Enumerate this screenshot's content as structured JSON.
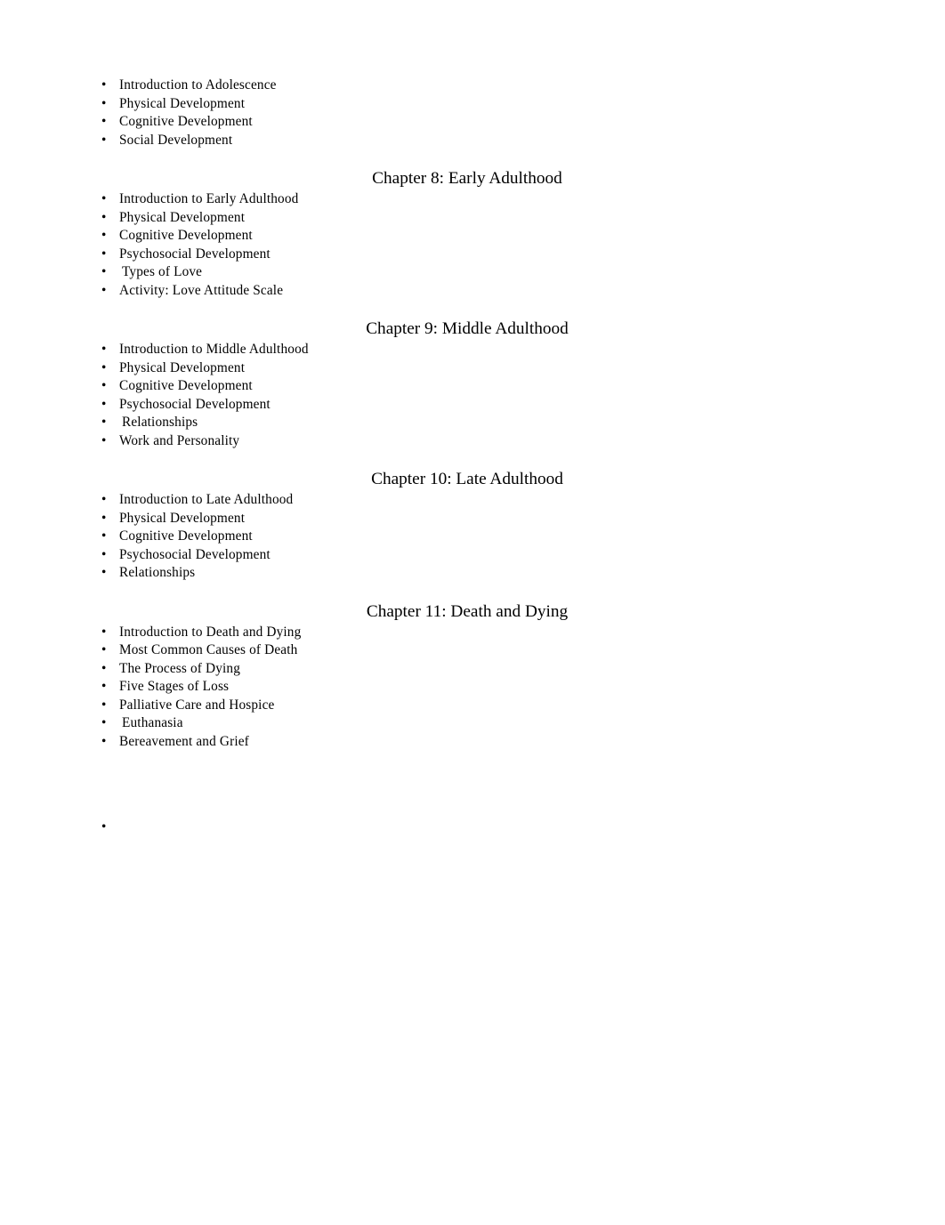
{
  "document": {
    "background_color": "#ffffff",
    "text_color": "#000000",
    "bullet_glyph": "•"
  },
  "sections": [
    {
      "heading": null,
      "items": [
        {
          "label": "Introduction to Adolescence",
          "indent": false
        },
        {
          "label": "Physical Development",
          "indent": false
        },
        {
          "label": "Cognitive Development",
          "indent": false
        },
        {
          "label": "Social Development",
          "indent": false
        }
      ]
    },
    {
      "heading": "Chapter 8: Early Adulthood",
      "items": [
        {
          "label": "Introduction to Early Adulthood",
          "indent": false
        },
        {
          "label": "Physical Development",
          "indent": false
        },
        {
          "label": "Cognitive Development",
          "indent": false
        },
        {
          "label": "Psychosocial Development",
          "indent": false
        },
        {
          "label": "Types of Love",
          "indent": true
        },
        {
          "label": "Activity: Love Attitude Scale",
          "indent": false
        }
      ]
    },
    {
      "heading": "Chapter 9: Middle Adulthood",
      "items": [
        {
          "label": "Introduction to Middle Adulthood",
          "indent": false
        },
        {
          "label": "Physical Development",
          "indent": false
        },
        {
          "label": "Cognitive Development",
          "indent": false
        },
        {
          "label": "Psychosocial Development",
          "indent": false
        },
        {
          "label": "Relationships",
          "indent": true
        },
        {
          "label": "Work and Personality",
          "indent": false
        }
      ]
    },
    {
      "heading": "Chapter 10: Late Adulthood",
      "items": [
        {
          "label": "Introduction to Late Adulthood",
          "indent": false
        },
        {
          "label": "Physical Development",
          "indent": false
        },
        {
          "label": "Cognitive Development",
          "indent": false
        },
        {
          "label": "Psychosocial Development",
          "indent": false
        },
        {
          "label": "Relationships",
          "indent": false
        }
      ]
    },
    {
      "heading": "Chapter 11: Death and Dying",
      "items": [
        {
          "label": "Introduction to Death and Dying",
          "indent": false
        },
        {
          "label": "Most Common Causes of Death",
          "indent": false
        },
        {
          "label": "The Process of Dying",
          "indent": false
        },
        {
          "label": "Five Stages of Loss",
          "indent": false
        },
        {
          "label": "Palliative Care and Hospice",
          "indent": false
        },
        {
          "label": "Euthanasia",
          "indent": true
        },
        {
          "label": "Bereavement and Grief",
          "indent": false
        }
      ]
    },
    {
      "heading": null,
      "items": [
        {
          "label": "",
          "indent": false
        }
      ]
    }
  ]
}
